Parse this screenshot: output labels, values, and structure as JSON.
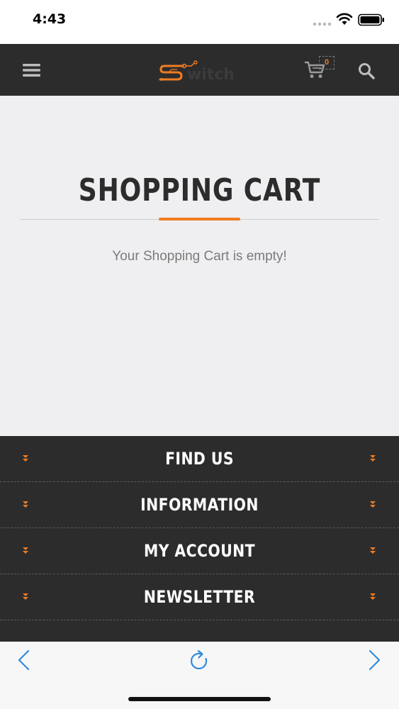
{
  "status_bar": {
    "time": "4:43"
  },
  "header": {
    "logo_alt": "Switch",
    "cart_count": "0",
    "icons": [
      "hamburger-menu-icon",
      "cart-icon",
      "search-icon"
    ]
  },
  "main": {
    "title": "SHOPPING CART",
    "empty_message": "Your Shopping Cart is empty!"
  },
  "footer": {
    "sections": [
      {
        "label": "FIND US"
      },
      {
        "label": "INFORMATION"
      },
      {
        "label": "MY ACCOUNT"
      },
      {
        "label": "NEWSLETTER"
      }
    ]
  },
  "browser_bar": {
    "icons": [
      "back-arrow-icon",
      "reload-icon",
      "forward-arrow-icon"
    ]
  },
  "colors": {
    "accent": "#f07c21",
    "header_bg": "#2d2c2d",
    "main_bg": "#efeef0",
    "link_blue": "#2f8ae0"
  }
}
